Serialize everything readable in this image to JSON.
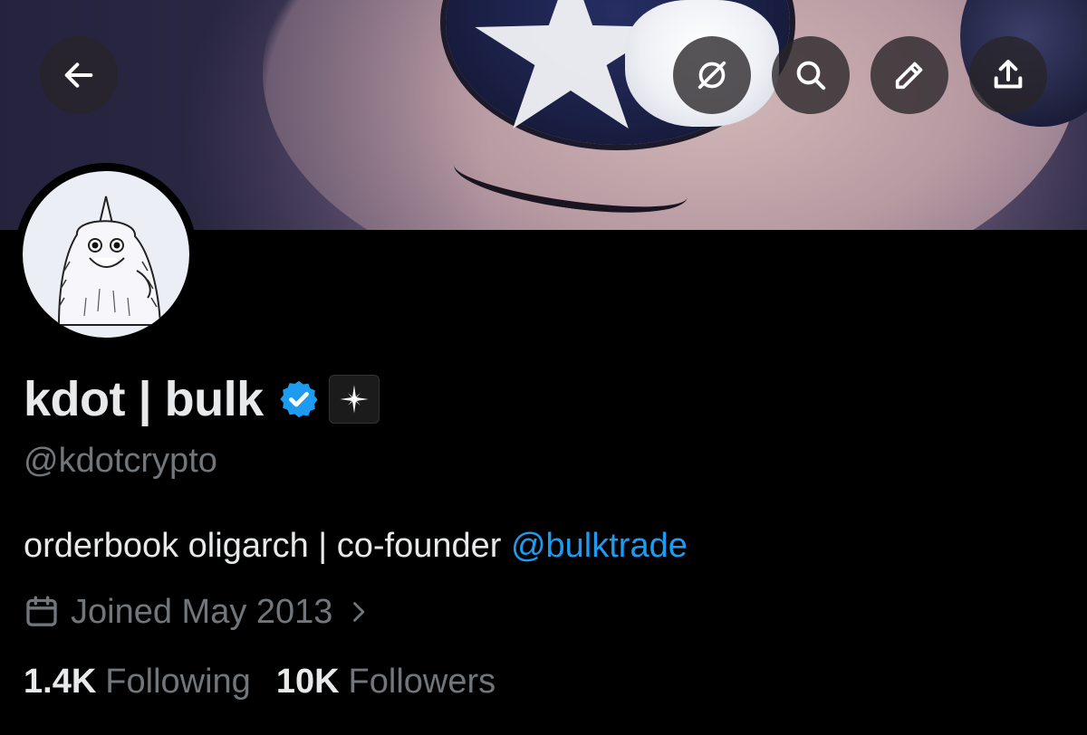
{
  "profile": {
    "display_name": "kdot | bulk",
    "handle": "@kdotcrypto",
    "bio_text": "orderbook oligarch | co-founder ",
    "bio_mention": "@bulktrade",
    "joined": "Joined May 2013",
    "following_count": "1.4K",
    "following_label": "Following",
    "followers_count": "10K",
    "followers_label": "Followers"
  },
  "header": {
    "actions": [
      {
        "icon": "back-arrow-icon"
      },
      {
        "icon": "grok-icon"
      },
      {
        "icon": "search-icon"
      },
      {
        "icon": "edit-icon"
      },
      {
        "icon": "share-icon"
      }
    ]
  },
  "colors": {
    "background": "#000000",
    "text_primary": "#e7e9ea",
    "text_secondary": "#71767b",
    "link": "#1d9bf0",
    "verified": "#1d9bf0"
  }
}
